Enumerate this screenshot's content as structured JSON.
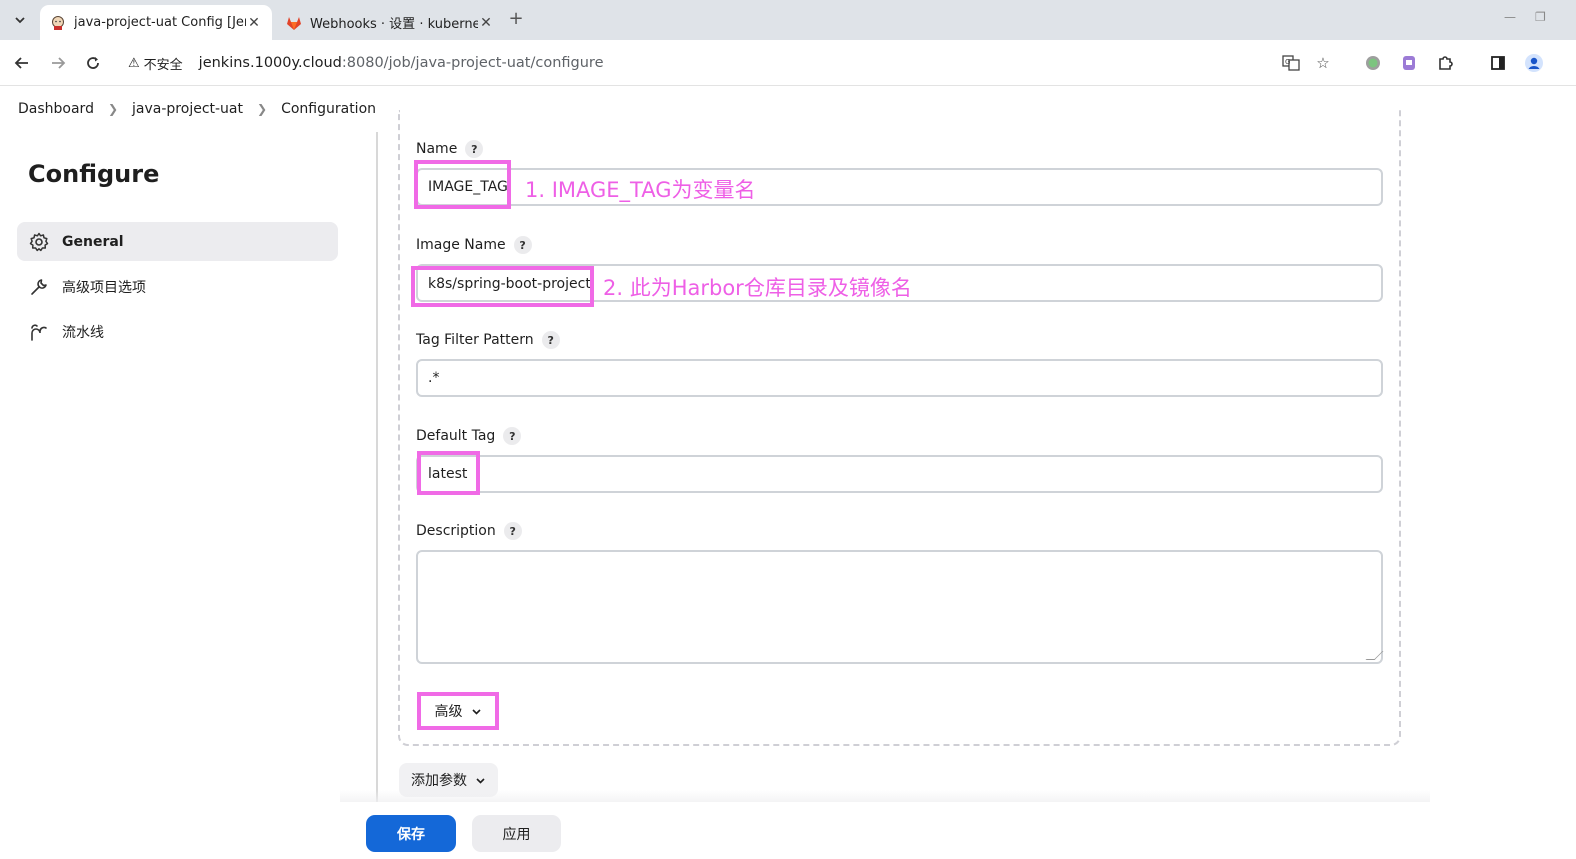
{
  "browser": {
    "tabs": [
      {
        "title": "java-project-uat Config [Jen",
        "active": true,
        "icon": "jenkins-icon"
      },
      {
        "title": "Webhooks · 设置 · kubernet",
        "active": false,
        "icon": "gitlab-icon"
      }
    ],
    "new_tab": "+",
    "security_label": "不安全",
    "url_host": "jenkins.1000y.cloud",
    "url_path": ":8080/job/java-project-uat/configure"
  },
  "breadcrumb": [
    "Dashboard",
    "java-project-uat",
    "Configuration"
  ],
  "sidebar": {
    "title": "Configure",
    "items": [
      {
        "label": "General",
        "icon": "gear-icon",
        "active": true
      },
      {
        "label": "高级项目选项",
        "icon": "wrench-icon",
        "active": false
      },
      {
        "label": "流水线",
        "icon": "pipeline-icon",
        "active": false
      }
    ]
  },
  "form": {
    "help": "?",
    "name_label": "Name",
    "name_value": "IMAGE_TAG",
    "image_name_label": "Image Name",
    "image_name_value": "k8s/spring-boot-project",
    "tag_filter_label": "Tag Filter Pattern",
    "tag_filter_value": ".*",
    "default_tag_label": "Default Tag",
    "default_tag_value": "latest",
    "description_label": "Description",
    "description_value": "",
    "advanced_label": "高级",
    "add_param_label": "添加参数"
  },
  "annotations": {
    "note1": "1. IMAGE_TAG为变量名",
    "note2": "2. 此为Harbor仓库目录及镜像名",
    "color": "#ee5fe6"
  },
  "actions": {
    "save_label": "保存",
    "apply_label": "应用"
  },
  "colors": {
    "primary": "#1468d8",
    "highlight": "#f06ae6"
  }
}
